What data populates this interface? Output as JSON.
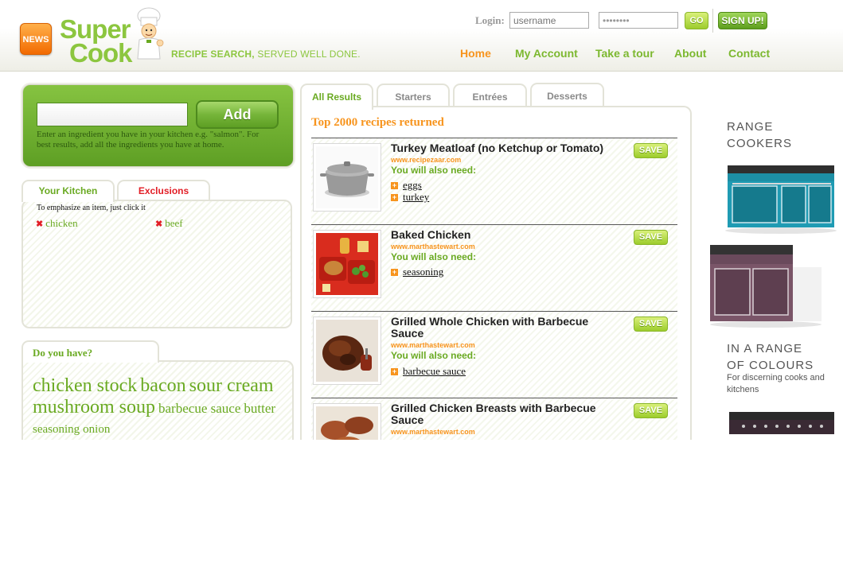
{
  "header": {
    "news_label": "NEWS",
    "logo_word1": "Super",
    "logo_word2": "Cook",
    "tagline_bold": "RECIPE SEARCH,",
    "tagline_rest": " SERVED WELL DONE.",
    "login_label": "Login:",
    "username_placeholder": "username",
    "password_value": "••••••••",
    "go_label": "GO",
    "signup_label": "SIGN UP!"
  },
  "nav": {
    "items": [
      "Home",
      "My Account",
      "Take a tour",
      "About",
      "Contact"
    ],
    "active": "Home"
  },
  "add_box": {
    "input_value": "",
    "button_label": "Add",
    "hint": "Enter an ingredient you have in your kitchen e.g. \"salmon\". For best results, add all the ingredients you have at home."
  },
  "kitchen": {
    "tabs": [
      "Your Kitchen",
      "Exclusions"
    ],
    "note": "To emphasize an item, just click it",
    "items": [
      "chicken",
      "beef"
    ],
    "remove_icon": "x-icon"
  },
  "do_you_have": {
    "title": "Do you have?",
    "large": [
      "chicken stock",
      "bacon",
      "sour cream",
      "mushroom soup"
    ],
    "medium": [
      "barbecue sauce",
      "butter"
    ],
    "small": [
      "seasoning",
      "onion"
    ]
  },
  "results": {
    "tabs": [
      "All Results",
      "Starters",
      "Entrées",
      "Desserts"
    ],
    "active_tab": "All Results",
    "count_text": "Top 2000 recipes returned",
    "need_label": "You will also need:",
    "save_label": "SAVE",
    "items": [
      {
        "title": "Turkey Meatloaf (no Ketchup or Tomato)",
        "source": "www.recipezaar.com",
        "ingredients": [
          "eggs",
          "turkey"
        ]
      },
      {
        "title": "Baked Chicken",
        "source": "www.marthastewart.com",
        "ingredients": [
          "seasoning"
        ]
      },
      {
        "title": "Grilled Whole Chicken with Barbecue Sauce",
        "source": "www.marthastewart.com",
        "ingredients": [
          "barbecue sauce"
        ]
      },
      {
        "title": "Grilled Chicken Breasts with Barbecue Sauce",
        "source": "www.marthastewart.com",
        "ingredients": []
      }
    ]
  },
  "ad": {
    "line1": "RANGE",
    "line2": "COOKERS",
    "line3": "IN A RANGE",
    "line4": "OF COLOURS",
    "small": "For discerning cooks and kitchens"
  },
  "colors": {
    "brand_green": "#8cc63f",
    "accent_orange": "#f7941d",
    "exclusion_red": "#e21e26"
  }
}
